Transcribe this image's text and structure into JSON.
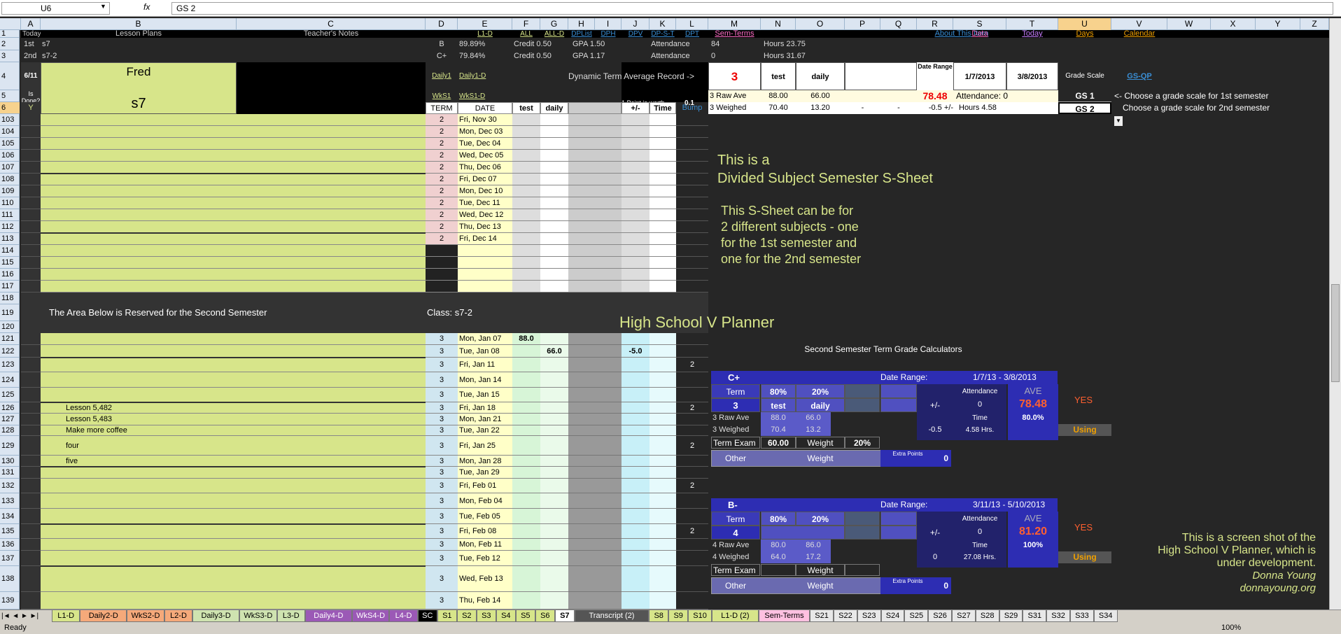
{
  "formula_bar": {
    "cell_ref": "U6",
    "fx": "fx",
    "formula": "GS 2"
  },
  "columns": [
    [
      "A",
      30,
      58
    ],
    [
      "B",
      58,
      338
    ],
    [
      "C",
      338,
      608
    ],
    [
      "D",
      608,
      654
    ],
    [
      "E",
      654,
      732
    ],
    [
      "F",
      732,
      772
    ],
    [
      "G",
      772,
      812
    ],
    [
      "H",
      812,
      850
    ],
    [
      "I",
      850,
      888
    ],
    [
      "J",
      888,
      928
    ],
    [
      "K",
      928,
      966
    ],
    [
      "L",
      966,
      1012
    ],
    [
      "M",
      1012,
      1087
    ],
    [
      "N",
      1087,
      1137
    ],
    [
      "O",
      1137,
      1207
    ],
    [
      "P",
      1207,
      1258
    ],
    [
      "Q",
      1258,
      1310
    ],
    [
      "R",
      1310,
      1362
    ],
    [
      "S",
      1362,
      1438
    ],
    [
      "T",
      1438,
      1512
    ],
    [
      "U",
      1512,
      1588
    ],
    [
      "V",
      1588,
      1668
    ],
    [
      "W",
      1668,
      1730
    ],
    [
      "X",
      1730,
      1794
    ],
    [
      "Y",
      1794,
      1858
    ],
    [
      "Z",
      1858,
      1899
    ]
  ],
  "rows": [
    [
      "1",
      43,
      11
    ],
    [
      "2",
      54,
      18
    ],
    [
      "3",
      72,
      17
    ],
    [
      "4",
      89,
      40
    ],
    [
      "5",
      129,
      17
    ],
    [
      "6",
      146,
      17
    ],
    [
      "103",
      163,
      17
    ],
    [
      "104",
      180,
      17
    ],
    [
      "105",
      197,
      17
    ],
    [
      "106",
      214,
      17
    ],
    [
      "107",
      231,
      17
    ],
    [
      "108",
      248,
      17
    ],
    [
      "109",
      265,
      17
    ],
    [
      "110",
      282,
      17
    ],
    [
      "111",
      299,
      17
    ],
    [
      "112",
      316,
      17
    ],
    [
      "113",
      333,
      17
    ],
    [
      "114",
      350,
      17
    ],
    [
      "115",
      367,
      17
    ],
    [
      "116",
      384,
      17
    ],
    [
      "117",
      401,
      17
    ],
    [
      "118",
      418,
      17
    ],
    [
      "119",
      435,
      24
    ],
    [
      "120",
      459,
      17
    ],
    [
      "121",
      476,
      17
    ],
    [
      "122",
      493,
      18
    ],
    [
      "123",
      511,
      21
    ],
    [
      "124",
      532,
      22
    ],
    [
      "125",
      554,
      21
    ],
    [
      "126",
      575,
      16
    ],
    [
      "127",
      591,
      17
    ],
    [
      "128",
      608,
      15
    ],
    [
      "129",
      623,
      28
    ],
    [
      "130",
      651,
      16
    ],
    [
      "131",
      667,
      17
    ],
    [
      "132",
      684,
      21
    ],
    [
      "133",
      705,
      22
    ],
    [
      "134",
      727,
      22
    ],
    [
      "135",
      749,
      21
    ],
    [
      "136",
      770,
      17
    ],
    [
      "137",
      787,
      22
    ],
    [
      "138",
      809,
      37
    ],
    [
      "139",
      846,
      25
    ]
  ],
  "row1": {
    "today": "Today",
    "lesson_plans": "Lesson Plans",
    "teachers_notes": "Teacher's Notes",
    "links": [
      "L1-D",
      "ALL",
      "ALL-D",
      "DPList",
      "DPH",
      "DPV",
      "DP-S-T",
      "DPT"
    ],
    "sem_terms": "Sem-Terms",
    "about": "About This Item",
    "data": "Data",
    "today_link": "Today",
    "days": "Days",
    "calendar": "Calendar"
  },
  "row2": {
    "a": "1st",
    "b": "s7",
    "d": "B",
    "e": "89.89%",
    "credit": "Credit 0.50",
    "gpa": "GPA 1.50",
    "att": "Attendance",
    "att_val": "84",
    "hours": "Hours 23.75"
  },
  "row3": {
    "a": "2nd",
    "b": "s7-2",
    "d": "C+",
    "e": "79.84%",
    "credit": "Credit 0.50",
    "gpa": "GPA 1.17",
    "att": "Attendance",
    "att_val": "0",
    "hours": "Hours 31.67"
  },
  "header": {
    "date": "6/11",
    "student": "Fred",
    "class": "s7",
    "is_done": "Is Done?",
    "y": "Y",
    "daily1": "Daily1",
    "daily1d": "Daily1-D",
    "wks1": "WkS1",
    "wks1d": "WkS1-D",
    "dtar": "Dynamic Term Average Record ->",
    "term_num": "3",
    "test": "test",
    "daily": "daily",
    "date_range": "Date Range",
    "dr_start": "1/7/2013",
    "dr_end": "3/8/2013",
    "grade_scale": "Grade Scale",
    "gsqp": "GS-QP",
    "point_worth": "1 Point is worth",
    "point_val": "0.1",
    "raw_ave": "3 Raw Ave",
    "raw_test": "88.00",
    "raw_daily": "66.00",
    "ave": "78.48",
    "att_label": "Attendance:",
    "att_val": "0",
    "gs1": "GS 1",
    "gs1_note": "<- Choose a grade scale for 1st semester",
    "col_term": "TERM",
    "col_date": "DATE",
    "col_test": "test",
    "col_daily": "daily",
    "col_pm": "+/-",
    "col_time": "Time",
    "col_bump": "Bump",
    "weighted": "3 Weighed",
    "w_test": "70.40",
    "w_daily": "13.20",
    "dash1": "-",
    "dash2": "-",
    "pm_val": "-0.5",
    "pm_label": "+/-",
    "hours_label": "Hours",
    "hours_val": "4.58",
    "gs2": "GS 2",
    "gs2_note": "Choose a grade scale for 2nd semester"
  },
  "first_sem_rows": [
    {
      "term": "2",
      "date": "Fri, Nov 30"
    },
    {
      "term": "2",
      "date": "Mon, Dec 03"
    },
    {
      "term": "2",
      "date": "Tue, Dec 04"
    },
    {
      "term": "2",
      "date": "Wed, Dec 05"
    },
    {
      "term": "2",
      "date": "Thu, Dec 06"
    },
    {
      "term": "2",
      "date": "Fri, Dec 07"
    },
    {
      "term": "2",
      "date": "Mon, Dec 10"
    },
    {
      "term": "2",
      "date": "Tue, Dec 11"
    },
    {
      "term": "2",
      "date": "Wed, Dec 12"
    },
    {
      "term": "2",
      "date": "Thu, Dec 13"
    },
    {
      "term": "2",
      "date": "Fri, Dec 14"
    }
  ],
  "notes_block": {
    "line1": "This is a",
    "line2": "Divided Subject Semester S-Sheet",
    "line3": "This S-Sheet can be for",
    "line4": "2 different subjects - one",
    "line5": "for the 1st semester and",
    "line6": "one for the 2nd semester"
  },
  "reserved": {
    "text": "The Area Below is Reserved for the Second Semester",
    "class": "Class:  s7-2",
    "planner": "High School V Planner"
  },
  "second_sem_rows": [
    {
      "term": "3",
      "date": "Mon, Jan 07",
      "test": "88.0",
      "daily": "",
      "pm": "",
      "bump": "",
      "lesson": ""
    },
    {
      "term": "3",
      "date": "Tue, Jan 08",
      "test": "",
      "daily": "66.0",
      "pm": "-5.0",
      "bump": "",
      "lesson": ""
    },
    {
      "term": "3",
      "date": "Fri, Jan 11",
      "test": "",
      "daily": "",
      "pm": "",
      "bump": "2",
      "lesson": ""
    },
    {
      "term": "3",
      "date": "Mon, Jan 14",
      "test": "",
      "daily": "",
      "pm": "",
      "bump": "",
      "lesson": ""
    },
    {
      "term": "3",
      "date": "Tue, Jan 15",
      "test": "",
      "daily": "",
      "pm": "",
      "bump": "",
      "lesson": ""
    },
    {
      "term": "3",
      "date": "Fri, Jan 18",
      "test": "",
      "daily": "",
      "pm": "",
      "bump": "2",
      "lesson": "Lesson 5,482"
    },
    {
      "term": "3",
      "date": "Mon, Jan 21",
      "test": "",
      "daily": "",
      "pm": "",
      "bump": "",
      "lesson": "Lesson 5,483"
    },
    {
      "term": "3",
      "date": "Tue, Jan 22",
      "test": "",
      "daily": "",
      "pm": "",
      "bump": "",
      "lesson": "Make more coffee"
    },
    {
      "term": "3",
      "date": "Fri, Jan 25",
      "test": "",
      "daily": "",
      "pm": "",
      "bump": "2",
      "lesson": "four"
    },
    {
      "term": "3",
      "date": "Mon, Jan 28",
      "test": "",
      "daily": "",
      "pm": "",
      "bump": "",
      "lesson": "five"
    },
    {
      "term": "3",
      "date": "Tue, Jan 29",
      "test": "",
      "daily": "",
      "pm": "",
      "bump": "",
      "lesson": ""
    },
    {
      "term": "3",
      "date": "Fri, Feb 01",
      "test": "",
      "daily": "",
      "pm": "",
      "bump": "2",
      "lesson": ""
    },
    {
      "term": "3",
      "date": "Mon, Feb 04",
      "test": "",
      "daily": "",
      "pm": "",
      "bump": "",
      "lesson": ""
    },
    {
      "term": "3",
      "date": "Tue, Feb 05",
      "test": "",
      "daily": "",
      "pm": "",
      "bump": "",
      "lesson": ""
    },
    {
      "term": "3",
      "date": "Fri, Feb 08",
      "test": "",
      "daily": "",
      "pm": "",
      "bump": "2",
      "lesson": ""
    },
    {
      "term": "3",
      "date": "Mon, Feb 11",
      "test": "",
      "daily": "",
      "pm": "",
      "bump": "",
      "lesson": ""
    },
    {
      "term": "3",
      "date": "Tue, Feb 12",
      "test": "",
      "daily": "",
      "pm": "",
      "bump": "",
      "lesson": ""
    },
    {
      "term": "3",
      "date": "Wed, Feb 13",
      "test": "",
      "daily": "",
      "pm": "",
      "bump": "",
      "lesson": ""
    },
    {
      "term": "3",
      "date": "Thu, Feb 14",
      "test": "",
      "daily": "",
      "pm": "",
      "bump": "",
      "lesson": ""
    }
  ],
  "calc_title": "Second Semester Term Grade Calculators",
  "calc1": {
    "grade": "C+",
    "date_range_label": "Date Range:",
    "date_range": "1/7/13 - 3/8/2013",
    "term_label": "Term",
    "pct1": "80%",
    "pct2": "20%",
    "term": "3",
    "test": "test",
    "daily": "daily",
    "pm": "+/-",
    "att_label": "Attendance",
    "att": "0",
    "ave_label": "AVE",
    "ave": "78.48",
    "ave_pct": "80.0%",
    "yes": "YES",
    "raw_label": "3 Raw Ave",
    "raw_test": "88.0",
    "raw_daily": "66.0",
    "time_label": "Time",
    "time": "4.58 Hrs.",
    "w_label": "3 Weighed",
    "w_test": "70.4",
    "w_daily": "13.2",
    "pm_val": "-0.5",
    "using": "Using",
    "exam_label": "Term Exam",
    "exam_val": "60.00",
    "weight_label": "Weight",
    "weight_val": "20%",
    "other_label": "Other",
    "other_weight": "Weight",
    "extra_label": "Extra Points",
    "extra_val": "0"
  },
  "calc2": {
    "grade": "B-",
    "date_range_label": "Date Range:",
    "date_range": "3/11/13 - 5/10/2013",
    "term_label": "Term",
    "pct1": "80%",
    "pct2": "20%",
    "term": "4",
    "pm": "+/-",
    "att_label": "Attendance",
    "att": "0",
    "ave_label": "AVE",
    "ave": "81.20",
    "ave_pct": "100%",
    "yes": "YES",
    "raw_label": "4 Raw Ave",
    "raw_test": "80.0",
    "raw_daily": "86.0",
    "time_label": "Time",
    "time": "27.08 Hrs.",
    "w_label": "4 Weighed",
    "w_test": "64.0",
    "w_daily": "17.2",
    "pm_val": "0",
    "using": "Using",
    "exam_label": "Term Exam",
    "weight_label": "Weight",
    "other_label": "Other",
    "other_weight": "Weight",
    "extra_label": "Extra Points",
    "extra_val": "0"
  },
  "screenshot_note": {
    "line1": "This is a screen shot of the",
    "line2": "High School V Planner, which is",
    "line3": "under development.",
    "line4": "Donna Young",
    "line5": "donnayoung.org"
  },
  "tabs": [
    {
      "label": "L1-D",
      "color": "#d7e58a"
    },
    {
      "label": "Daily2-D",
      "color": "#f5a97a"
    },
    {
      "label": "WkS2-D",
      "color": "#f5a97a"
    },
    {
      "label": "L2-D",
      "color": "#f5a97a"
    },
    {
      "label": "Daily3-D",
      "color": "#cfe3b0"
    },
    {
      "label": "WkS3-D",
      "color": "#cfe3b0"
    },
    {
      "label": "L3-D",
      "color": "#cfe3b0"
    },
    {
      "label": "Daily4-D",
      "color": "#9b59b6"
    },
    {
      "label": "WkS4-D",
      "color": "#9b59b6"
    },
    {
      "label": "L4-D",
      "color": "#9b59b6"
    },
    {
      "label": "SC",
      "color": "#000000"
    },
    {
      "label": "S1",
      "color": "#d7e58a"
    },
    {
      "label": "S2",
      "color": "#d7e58a"
    },
    {
      "label": "S3",
      "color": "#d7e58a"
    },
    {
      "label": "S4",
      "color": "#d7e58a"
    },
    {
      "label": "S5",
      "color": "#d7e58a"
    },
    {
      "label": "S6",
      "color": "#d7e58a"
    },
    {
      "label": "S7",
      "color": "#ffffff"
    },
    {
      "label": "Transcript (2)",
      "color": "#555555"
    },
    {
      "label": "S8",
      "color": "#d7e58a"
    },
    {
      "label": "S9",
      "color": "#d7e58a"
    },
    {
      "label": "S10",
      "color": "#d7e58a"
    },
    {
      "label": "L1-D (2)",
      "color": "#d7e58a"
    },
    {
      "label": "Sem-Terms",
      "color": "#ffc0e0"
    },
    {
      "label": "S21",
      "color": "#e8e8e8"
    },
    {
      "label": "S22",
      "color": "#e8e8e8"
    },
    {
      "label": "S23",
      "color": "#e8e8e8"
    },
    {
      "label": "S24",
      "color": "#e8e8e8"
    },
    {
      "label": "S25",
      "color": "#e8e8e8"
    },
    {
      "label": "S26",
      "color": "#e8e8e8"
    },
    {
      "label": "S27",
      "color": "#e8e8e8"
    },
    {
      "label": "S28",
      "color": "#e8e8e8"
    },
    {
      "label": "S29",
      "color": "#e8e8e8"
    },
    {
      "label": "S31",
      "color": "#e8e8e8"
    },
    {
      "label": "S32",
      "color": "#e8e8e8"
    },
    {
      "label": "S33",
      "color": "#e8e8e8"
    },
    {
      "label": "S34",
      "color": "#e8e8e8"
    }
  ],
  "status": {
    "ready": "Ready",
    "zoom": "100%"
  }
}
